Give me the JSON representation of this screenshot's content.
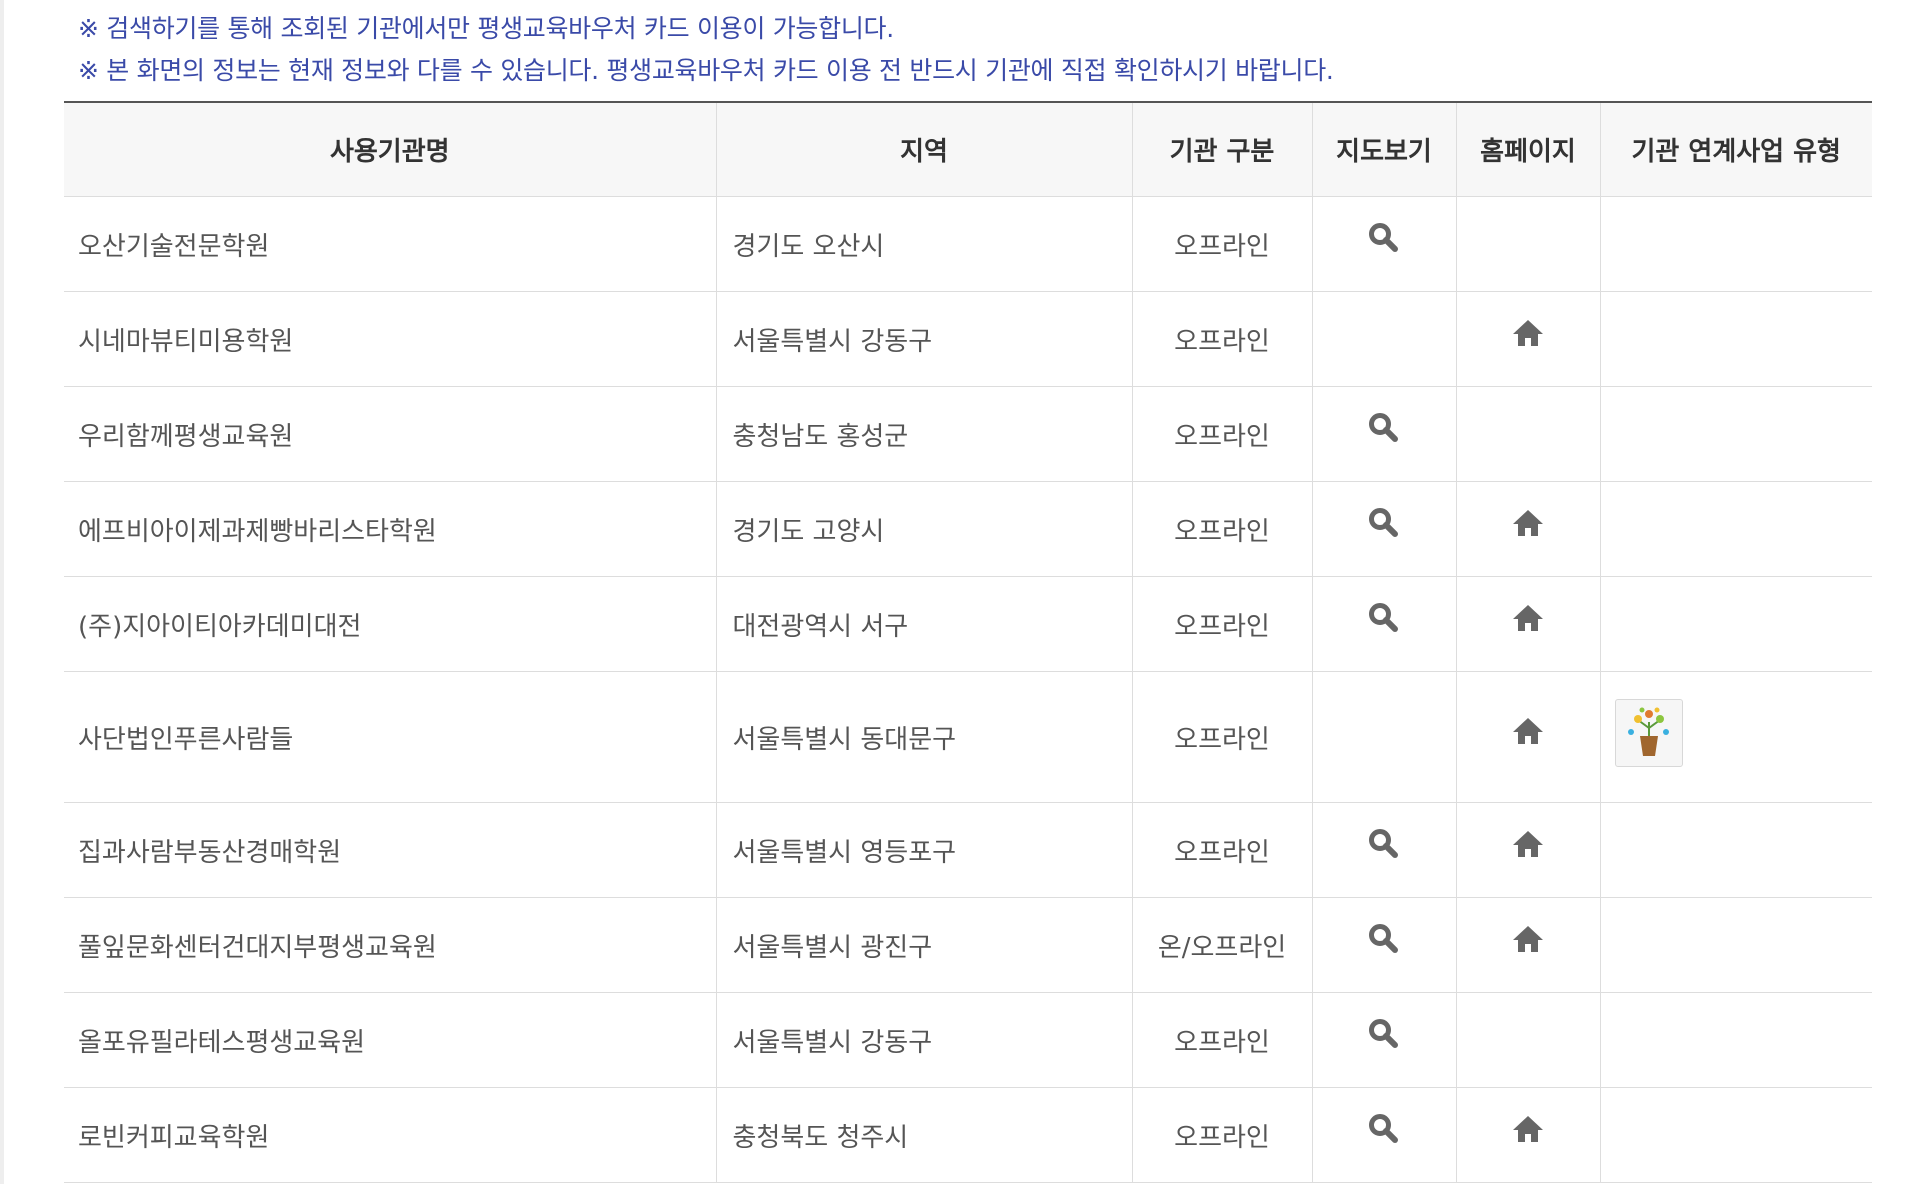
{
  "notices": [
    "※ 검색하기를 통해 조회된 기관에서만 평생교육바우처 카드 이용이 가능합니다.",
    "※ 본 화면의 정보는 현재 정보와 다를 수 있습니다. 평생교육바우처 카드 이용 전 반드시 기관에 직접 확인하시기 바랍니다."
  ],
  "table": {
    "headers": {
      "name": "사용기관명",
      "region": "지역",
      "category": "기관 구분",
      "map": "지도보기",
      "homepage": "홈페이지",
      "program_type": "기관 연계사업 유형"
    },
    "rows": [
      {
        "name": "오산기술전문학원",
        "region": "경기도 오산시",
        "category": "오프라인",
        "map": true,
        "homepage": false,
        "program_badge": false
      },
      {
        "name": "시네마뷰티미용학원",
        "region": "서울특별시 강동구",
        "category": "오프라인",
        "map": false,
        "homepage": true,
        "program_badge": false
      },
      {
        "name": "우리함께평생교육원",
        "region": "충청남도 홍성군",
        "category": "오프라인",
        "map": true,
        "homepage": false,
        "program_badge": false
      },
      {
        "name": "에프비아이제과제빵바리스타학원",
        "region": "경기도 고양시",
        "category": "오프라인",
        "map": true,
        "homepage": true,
        "program_badge": false
      },
      {
        "name": "(주)지아이티아카데미대전",
        "region": "대전광역시 서구",
        "category": "오프라인",
        "map": true,
        "homepage": true,
        "program_badge": false
      },
      {
        "name": "사단법인푸른사람들",
        "region": "서울특별시 동대문구",
        "category": "오프라인",
        "map": false,
        "homepage": true,
        "program_badge": true
      },
      {
        "name": "집과사람부동산경매학원",
        "region": "서울특별시 영등포구",
        "category": "오프라인",
        "map": true,
        "homepage": true,
        "program_badge": false
      },
      {
        "name": "풀잎문화센터건대지부평생교육원",
        "region": "서울특별시 광진구",
        "category": "온/오프라인",
        "map": true,
        "homepage": true,
        "program_badge": false
      },
      {
        "name": "올포유필라테스평생교육원",
        "region": "서울특별시 강동구",
        "category": "오프라인",
        "map": true,
        "homepage": false,
        "program_badge": false
      },
      {
        "name": "로빈커피교육학원",
        "region": "충청북도 청주시",
        "category": "오프라인",
        "map": true,
        "homepage": true,
        "program_badge": false
      }
    ]
  },
  "icons": {
    "map": "magnifier-icon",
    "homepage": "home-icon",
    "program_badge": "plant-pot-badge-icon"
  },
  "colors": {
    "notice_text": "#3a4aa8",
    "header_bg": "#f7f7f7",
    "icon_gray": "#666666"
  }
}
